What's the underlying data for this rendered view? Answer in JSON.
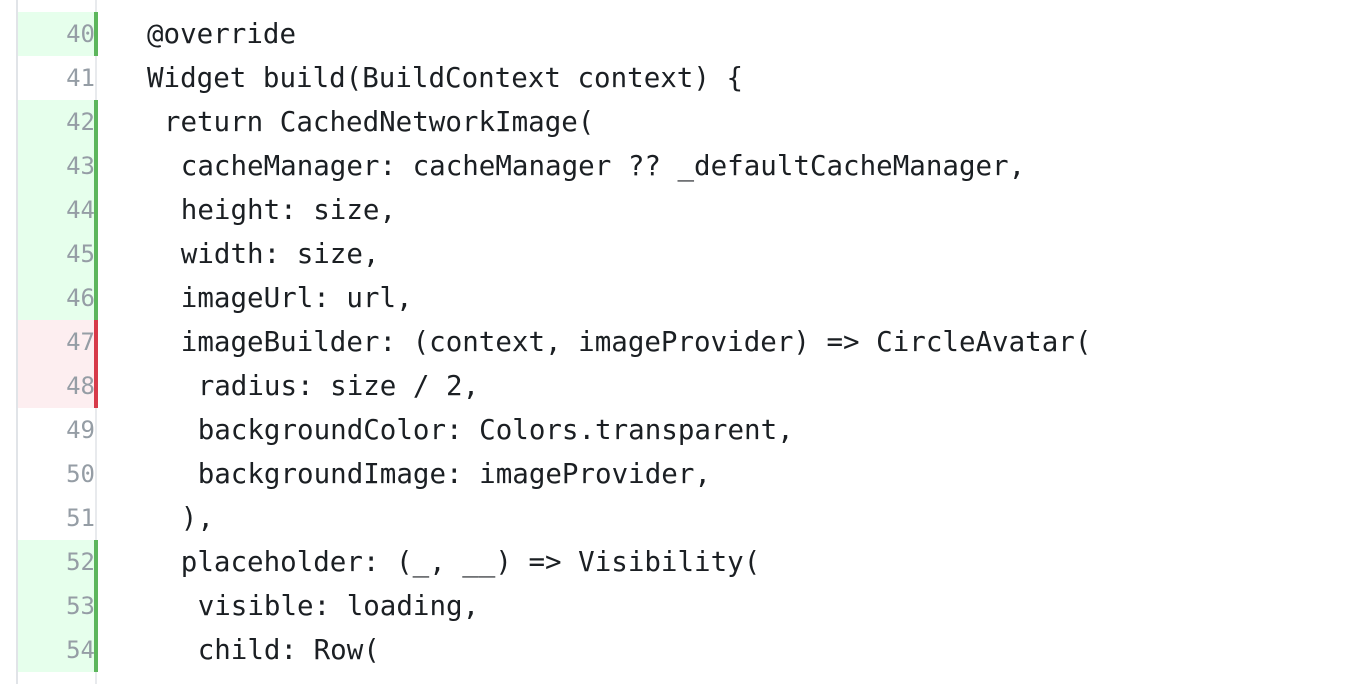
{
  "diff": {
    "colors": {
      "added_bg": "#e6ffec",
      "added_marker": "#5cb65c",
      "removed_bg": "#fdeef0",
      "removed_marker": "#d73a49"
    },
    "lines": [
      {
        "number": "40",
        "status": "added",
        "indent": 0,
        "text": "@override"
      },
      {
        "number": "41",
        "status": "none",
        "indent": 0,
        "text": "Widget build(BuildContext context) {"
      },
      {
        "number": "42",
        "status": "added",
        "indent": 2,
        "text": "return CachedNetworkImage("
      },
      {
        "number": "43",
        "status": "added",
        "indent": 4,
        "text": "cacheManager: cacheManager ?? _defaultCacheManager,"
      },
      {
        "number": "44",
        "status": "added",
        "indent": 4,
        "text": "height: size,"
      },
      {
        "number": "45",
        "status": "added",
        "indent": 4,
        "text": "width: size,"
      },
      {
        "number": "46",
        "status": "added",
        "indent": 4,
        "text": "imageUrl: url,"
      },
      {
        "number": "47",
        "status": "removed",
        "indent": 4,
        "text": "imageBuilder: (context, imageProvider) => CircleAvatar("
      },
      {
        "number": "48",
        "status": "removed",
        "indent": 6,
        "text": "radius: size / 2,"
      },
      {
        "number": "49",
        "status": "none",
        "indent": 6,
        "text": "backgroundColor: Colors.transparent,"
      },
      {
        "number": "50",
        "status": "none",
        "indent": 6,
        "text": "backgroundImage: imageProvider,"
      },
      {
        "number": "51",
        "status": "none",
        "indent": 4,
        "text": "),"
      },
      {
        "number": "52",
        "status": "added",
        "indent": 4,
        "text": "placeholder: (_, __) => Visibility("
      },
      {
        "number": "53",
        "status": "added",
        "indent": 6,
        "text": "visible: loading,"
      },
      {
        "number": "54",
        "status": "added",
        "indent": 6,
        "text": "child: Row("
      }
    ]
  }
}
